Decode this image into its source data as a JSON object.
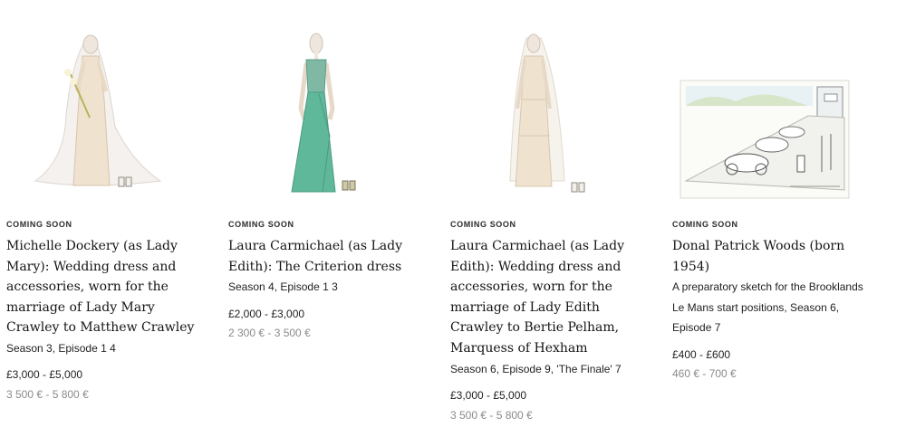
{
  "lots": [
    {
      "status": "COMING SOON",
      "title": "Michelle Dockery (as Lady Mary): Wedding dress and accessories, worn for the marriage of Lady Mary Crawley to Matthew Crawley",
      "episode": "Season 3, Episode 1 4",
      "price_gbp": "£3,000 - £5,000",
      "price_eur": "3 500 € - 5 800 €",
      "image_icon": "wedding-dress-mannequin"
    },
    {
      "status": "COMING SOON",
      "title": "Laura Carmichael (as Lady Edith): The Criterion dress",
      "episode": "Season 4, Episode 1 3",
      "price_gbp": "£2,000 - £3,000",
      "price_eur": "2 300 € - 3 500 €",
      "image_icon": "green-evening-dress-mannequin"
    },
    {
      "status": "COMING SOON",
      "title": "Laura Carmichael (as Lady Edith): Wedding dress and accessories, worn for the marriage of Lady Edith Crawley to Bertie Pelham, Marquess of Hexham",
      "episode": "Season 6, Episode 9, 'The Finale' 7",
      "price_gbp": "£3,000 - £5,000",
      "price_eur": "3 500 € - 5 800 €",
      "image_icon": "lace-wedding-dress-mannequin"
    },
    {
      "status": "COMING SOON",
      "title": "Donal Patrick Woods (born 1954)",
      "episode": "A preparatory sketch for the Brooklands Le Mans start positions, Season 6, Episode 7",
      "price_gbp": "£400 - £600",
      "price_eur": "460 € - 700 €",
      "image_icon": "racing-car-sketch"
    }
  ],
  "colors": {
    "status_text": "#2b2b2b",
    "title_text": "#141414",
    "eur_text": "#8a8a8a",
    "green_dress": "#5fb89a",
    "ivory_dress": "#efe2cf"
  }
}
